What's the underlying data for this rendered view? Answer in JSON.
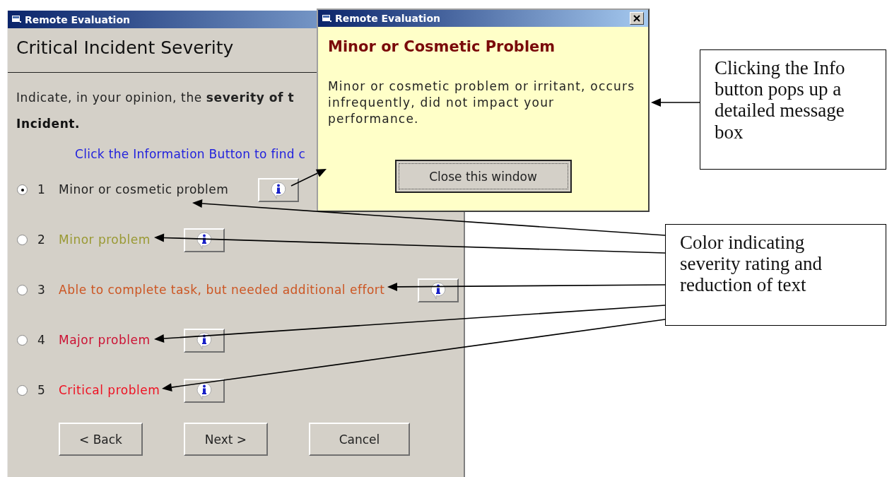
{
  "main_window": {
    "title": "Remote Evaluation",
    "heading": "Critical Incident Severity",
    "prompt": "Indicate, in your opinion, the **severity of t**",
    "prompt_line_2": "Incident.",
    "hint": "Click the Information Button to find c",
    "options": [
      {
        "number": "1",
        "label": "Minor or cosmetic problem",
        "color": "#222222",
        "selected": true
      },
      {
        "number": "2",
        "label": "Minor problem",
        "color": "#999933",
        "selected": false
      },
      {
        "number": "3",
        "label": "Able to complete task, but needed additional effort",
        "color": "#cc5522",
        "selected": false
      },
      {
        "number": "4",
        "label": "Major problem",
        "color": "#cc1133",
        "selected": false
      },
      {
        "number": "5",
        "label": "Critical problem",
        "color": "#ee1122",
        "selected": false
      }
    ],
    "buttons": [
      "< Back",
      "Next >",
      "Cancel"
    ]
  },
  "popup": {
    "title": "Remote Evaluation",
    "heading": "Minor or Cosmetic Problem",
    "message": "Minor or cosmetic problem or irritant, occurs infrequently, did not impact your performance.",
    "button": "Close this window"
  },
  "callouts": [
    {
      "text": "Clicking the Info button pops up a detailed message box"
    },
    {
      "text": "Color indicating severity rating and reduction of text"
    }
  ]
}
